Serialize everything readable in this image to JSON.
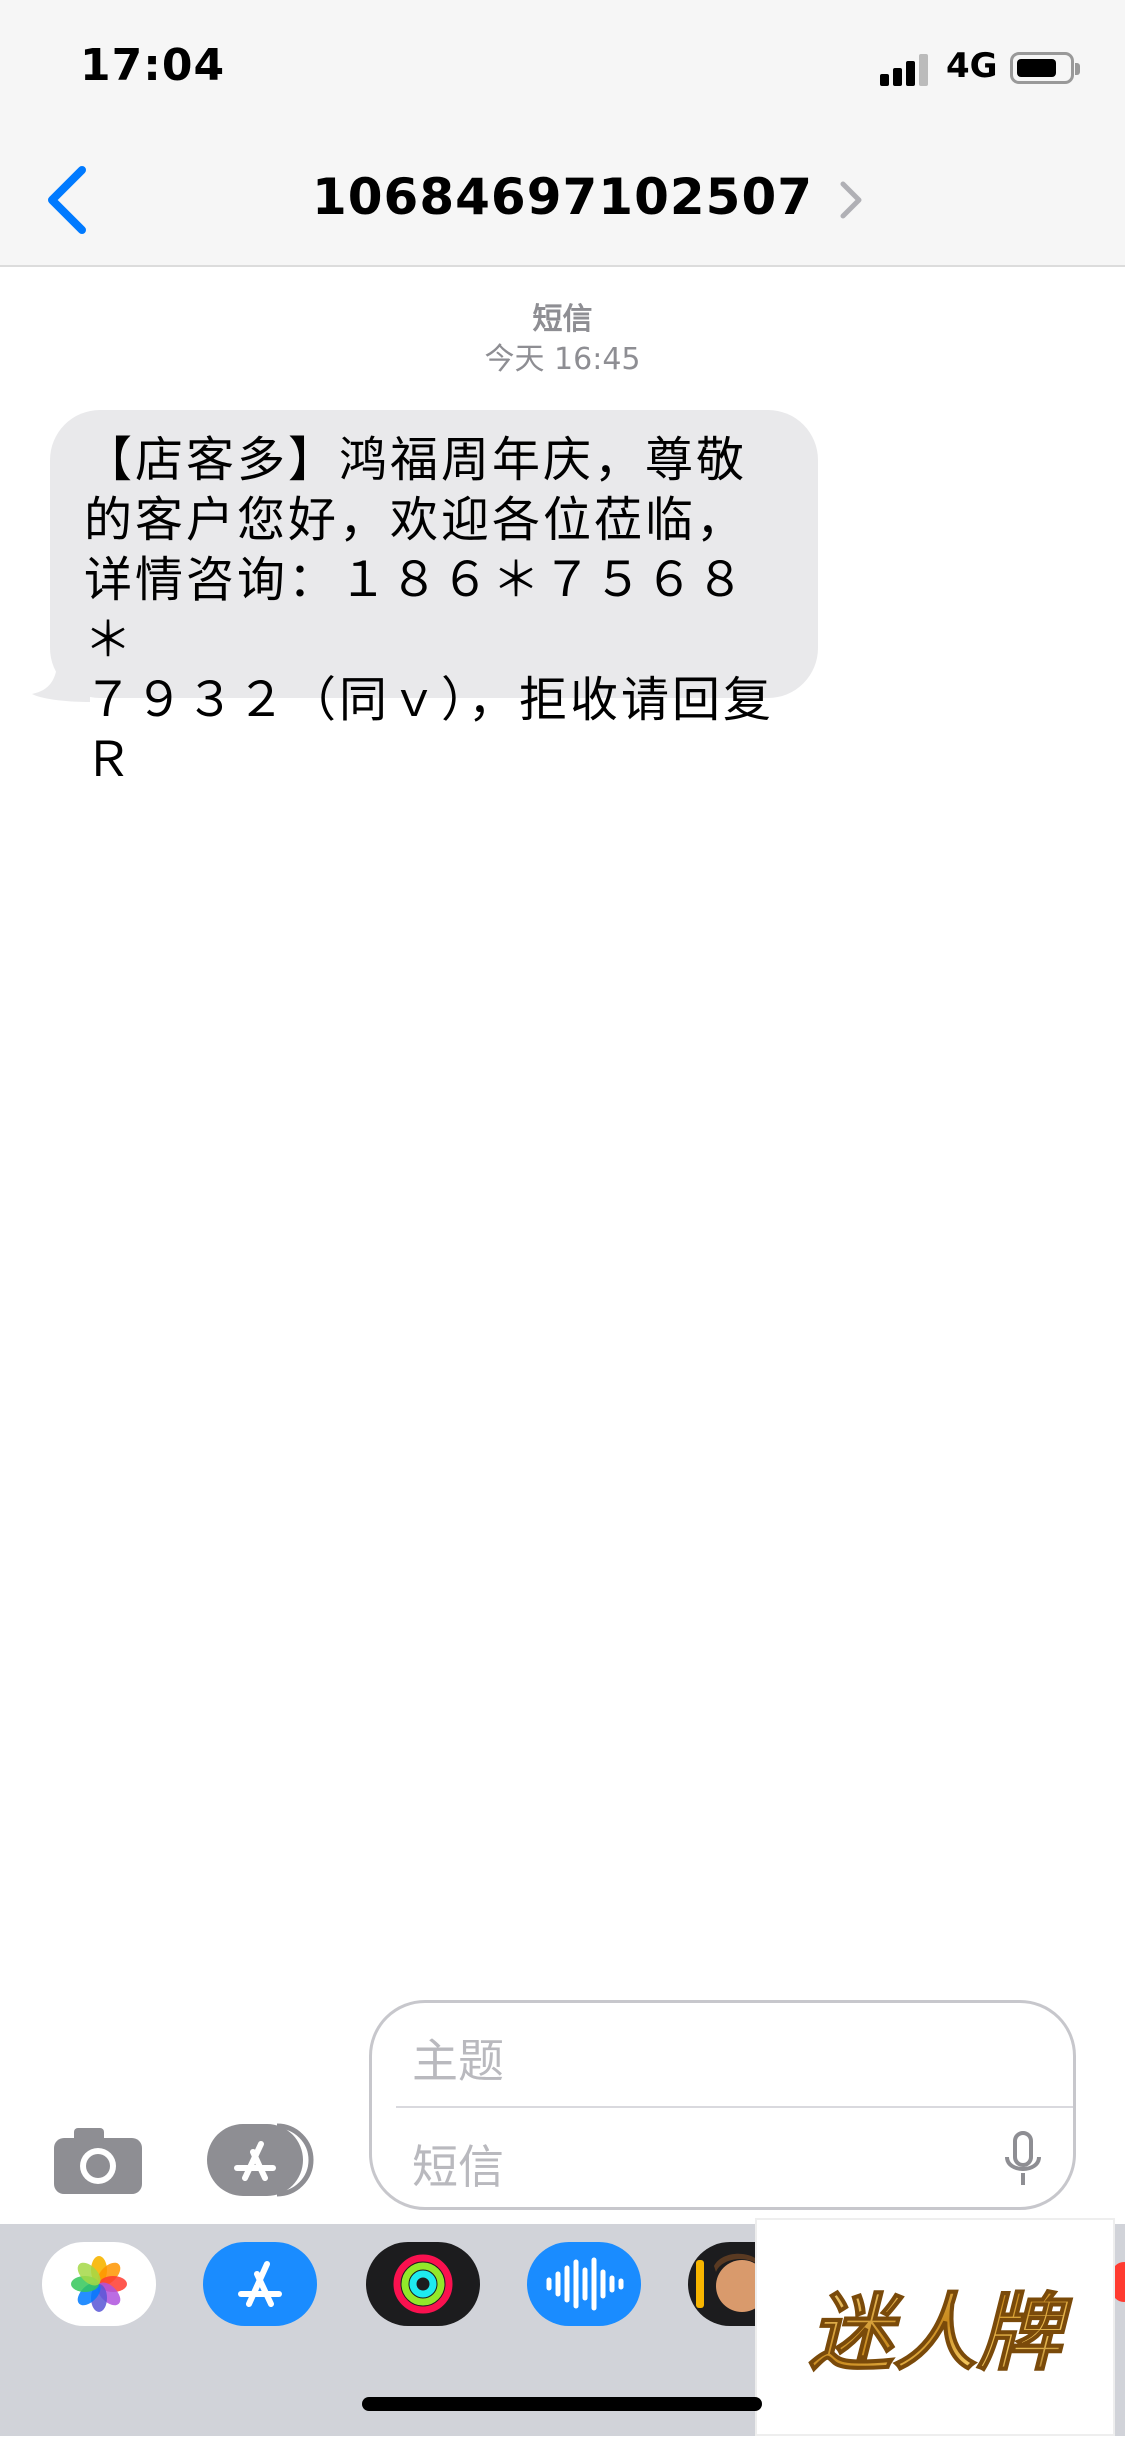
{
  "status_bar": {
    "time": "17:04",
    "network": "4G"
  },
  "header": {
    "contact": "10684697102507"
  },
  "thread": {
    "service_label": "短信",
    "timestamp": "今天 16:45",
    "message_lines": [
      "【店客多】鸿福周年庆，尊敬",
      "的客户您好，欢迎各位莅临，",
      "详情咨询：１８６＊７５６８＊",
      "７９３２（同ｖ），拒收请回复Ｒ"
    ]
  },
  "composer": {
    "subject_placeholder": "主题",
    "message_placeholder": "短信"
  },
  "app_drawer": {
    "apps": [
      "photos-icon",
      "app-store-icon",
      "activity-icon",
      "audio-message-icon",
      "memoji-icon"
    ],
    "watermark_text": "迷人牌"
  },
  "colors": {
    "accent": "#007aff",
    "bubble": "#e9e9eb",
    "drawer": "#d1d3d9"
  }
}
